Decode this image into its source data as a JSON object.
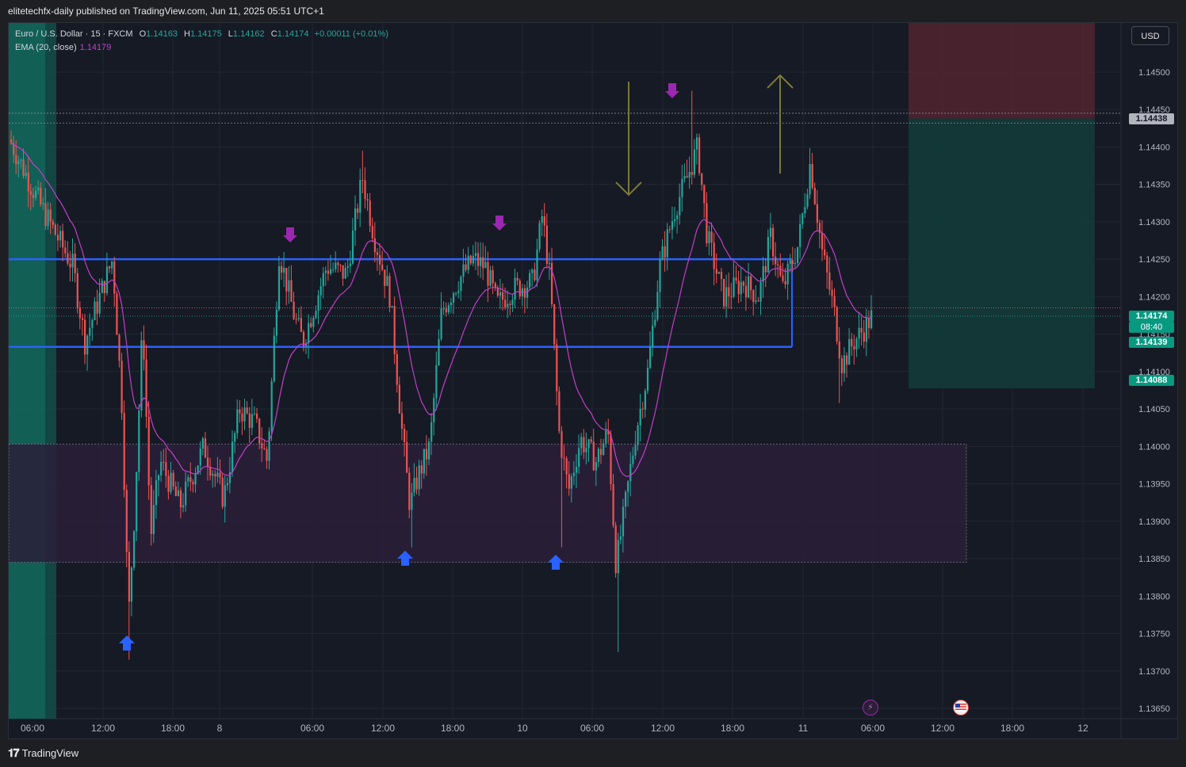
{
  "header": {
    "published_line": "elitetechfx-daily published on TradingView.com, Jun 11, 2025 05:51 UTC+1"
  },
  "legend": {
    "symbol": "Euro / U.S. Dollar · 15 · FXCM",
    "open_label": "O",
    "open": "1.14163",
    "high_label": "H",
    "high": "1.14175",
    "low_label": "L",
    "low": "1.14162",
    "close_label": "C",
    "close": "1.14174",
    "change": "+0.00011 (+0.01%)",
    "ema_label": "EMA (20, close)",
    "ema_value": "1.14179"
  },
  "currency_button": "USD",
  "price_axis": {
    "ticks": [
      "1.14500",
      "1.14450",
      "1.14400",
      "1.14350",
      "1.14300",
      "1.14250",
      "1.14200",
      "1.14150",
      "1.14100",
      "1.14050",
      "1.14000",
      "1.13950",
      "1.13900",
      "1.13850",
      "1.13800",
      "1.13750",
      "1.13700",
      "1.13650"
    ],
    "tags": {
      "sl_level": "1.14438",
      "last_price": "1.14174",
      "countdown": "08:40",
      "entry": "1.14139",
      "target": "1.14088"
    }
  },
  "time_axis": {
    "labels": [
      "06:00",
      "12:00",
      "18:00",
      "8",
      "06:00",
      "12:00",
      "18:00",
      "10",
      "06:00",
      "12:00",
      "18:00",
      "11",
      "06:00",
      "12:00",
      "18:00",
      "12"
    ]
  },
  "footer": {
    "brand": "TradingView"
  },
  "colors": {
    "up": "#26a69a",
    "down": "#ef5350",
    "ema": "#c33fc8",
    "zone_line": "#2962ff",
    "demand_zone": "#2a1f3a",
    "arrow_up": "#2962ff",
    "arrow_down": "#9c27b0",
    "projection": "#7a7a3a"
  },
  "chart_data": {
    "type": "candlestick",
    "symbol": "EURUSD",
    "timeframe": "15",
    "ylim": [
      1.1364,
      1.1452
    ],
    "resistance_zone": [
      1.14133,
      1.1425
    ],
    "demand_zone": [
      1.13845,
      1.14003
    ],
    "position": {
      "stop": 1.14438,
      "entry": 1.14139,
      "target": 1.14088,
      "side": "short"
    },
    "current_price": 1.14174,
    "ema20_last": 1.14179
  }
}
